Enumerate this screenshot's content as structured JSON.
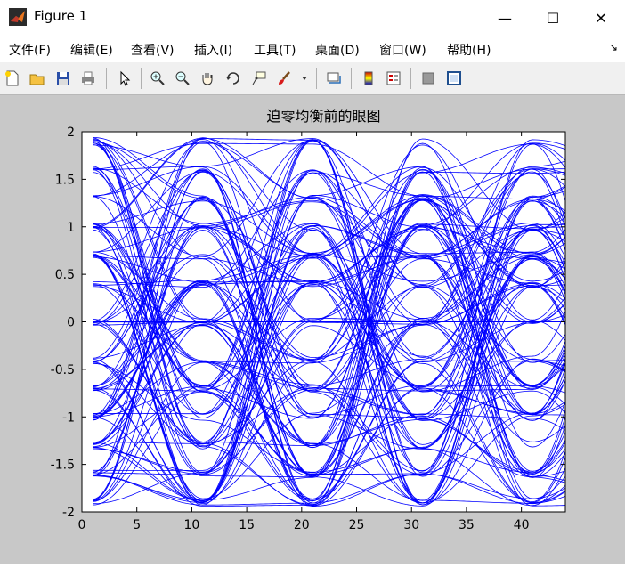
{
  "window": {
    "title": "Figure 1",
    "minimize": "—",
    "maximize": "☐",
    "close": "✕"
  },
  "menu": [
    {
      "label": "文件(F)"
    },
    {
      "label": "编辑(E)"
    },
    {
      "label": "查看(V)"
    },
    {
      "label": "插入(I)"
    },
    {
      "label": "工具(T)"
    },
    {
      "label": "桌面(D)"
    },
    {
      "label": "窗口(W)"
    },
    {
      "label": "帮助(H)"
    }
  ],
  "toolbar_icons": [
    "new-figure-icon",
    "open-file-icon",
    "save-icon",
    "print-icon",
    "edit-plot-arrow-icon",
    "zoom-in-icon",
    "zoom-out-icon",
    "pan-hand-icon",
    "rotate-3d-icon",
    "data-cursor-icon",
    "brush-icon",
    "link-plot-icon",
    "colorbar-icon",
    "legend-icon",
    "hide-plot-tools-icon",
    "show-plot-tools-icon"
  ],
  "chart_data": {
    "type": "line",
    "title": "迫零均衡前的眼图",
    "xlabel": "",
    "ylabel": "",
    "xlim": [
      0,
      44
    ],
    "ylim": [
      -2,
      2
    ],
    "xticks": [
      0,
      5,
      10,
      15,
      20,
      25,
      30,
      35,
      40
    ],
    "yticks": [
      -2,
      -1.5,
      -1,
      -0.5,
      0,
      0.5,
      1,
      1.5,
      2
    ],
    "line_color": "#0000ff",
    "symbol_period": 10,
    "first_crossing_x": 6,
    "trace_x_range": [
      1,
      44
    ],
    "trace_count": 120,
    "amplitude_levels": [
      -1.9,
      -1.6,
      -1.3,
      -1.0,
      -0.7,
      -0.4,
      0,
      0.4,
      0.7,
      1.0,
      1.3,
      1.6,
      1.9
    ],
    "grid": false
  }
}
